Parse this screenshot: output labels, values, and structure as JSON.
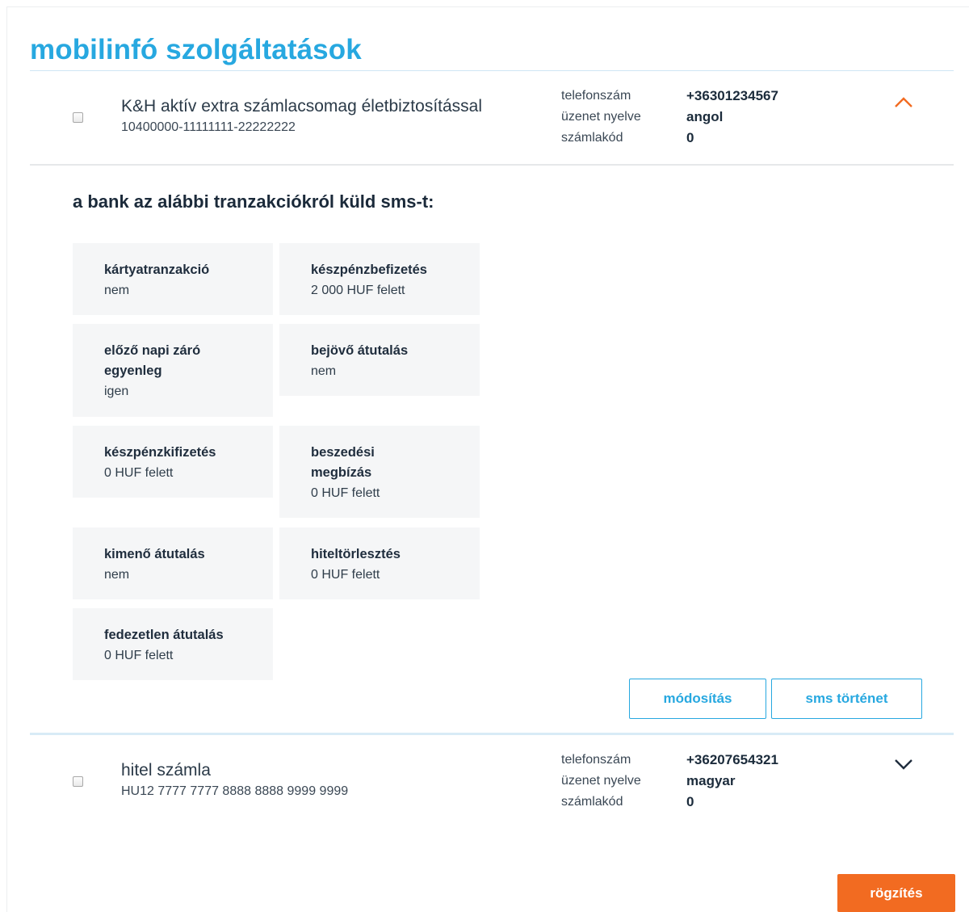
{
  "page": {
    "title": "mobilinfó szolgáltatások"
  },
  "accounts": [
    {
      "name": "K&H aktív extra számlacsomag életbiztosítással",
      "number": "10400000-11111111-22222222",
      "phone_label": "telefonszám",
      "phone": "+36301234567",
      "lang_label": "üzenet nyelve",
      "lang": "angol",
      "code_label": "számlakód",
      "code": "0",
      "expanded": true
    },
    {
      "name": "hitel számla",
      "number": "HU12 7777 7777 8888 8888 9999 9999",
      "phone_label": "telefonszám",
      "phone": "+36207654321",
      "lang_label": "üzenet nyelve",
      "lang": "magyar",
      "code_label": "számlakód",
      "code": "0",
      "expanded": false
    }
  ],
  "details": {
    "heading": "a bank az alábbi tranzakciókról küld sms-t:",
    "tiles": [
      {
        "label": "kártyatranzakció",
        "value": "nem"
      },
      {
        "label": "készpénzbefizetés",
        "value": "2 000 HUF felett"
      },
      {
        "label": "előző napi záró",
        "label2": "egyenleg",
        "value": "igen"
      },
      {
        "label": "bejövő átutalás",
        "value": "nem"
      },
      {
        "label": "készpénzkifizetés",
        "value": "0 HUF felett"
      },
      {
        "label": "beszedési",
        "label2": "megbízás",
        "value": "0 HUF felett"
      },
      {
        "label": "kimenő átutalás",
        "value": "nem"
      },
      {
        "label": "hiteltörlesztés",
        "value": "0 HUF felett"
      },
      {
        "label": "fedezetlen átutalás",
        "value": "0 HUF felett"
      }
    ],
    "modify_label": "módosítás",
    "history_label": "sms történet"
  },
  "footer": {
    "save_label": "rögzítés"
  },
  "colors": {
    "accent_blue": "#27a8e0",
    "accent_orange": "#f26b21",
    "tile_bg": "#f5f6f7"
  },
  "icons": {
    "expanded": "chevron-up-icon",
    "collapsed": "chevron-down-icon"
  }
}
